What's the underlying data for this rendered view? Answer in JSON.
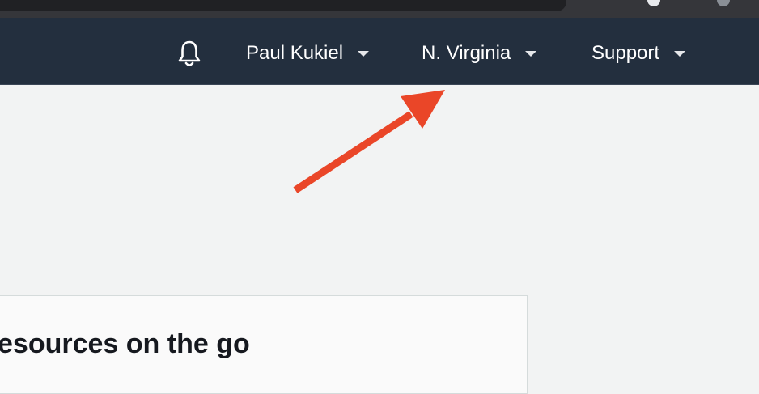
{
  "topnav": {
    "bell_icon": "bell-icon",
    "account_label": "Paul Kukiel",
    "region_label": "N. Virginia",
    "support_label": "Support"
  },
  "main": {
    "card_heading": "esources on the go"
  },
  "colors": {
    "nav_background": "#232f3e",
    "page_background": "#f2f3f3",
    "annotation_arrow": "#ea4628"
  }
}
